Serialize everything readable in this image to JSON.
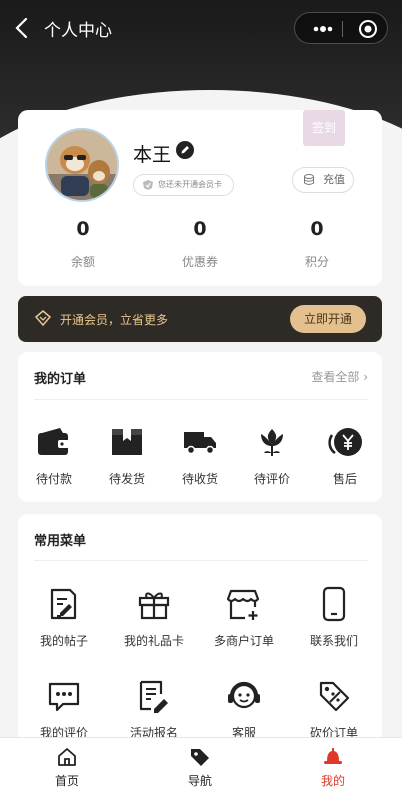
{
  "header": {
    "title": "个人中心"
  },
  "profile": {
    "username": "本王",
    "member_status": "您还未开通会员卡",
    "checkin_label": "签到",
    "recharge_label": "充值",
    "stats": [
      {
        "value": "0",
        "label": "余额"
      },
      {
        "value": "0",
        "label": "优惠券"
      },
      {
        "value": "0",
        "label": "积分"
      }
    ]
  },
  "vip": {
    "text": "开通会员，立省更多",
    "button": "立即开通"
  },
  "orders": {
    "title": "我的订单",
    "view_all": "查看全部",
    "items": [
      {
        "label": "待付款",
        "icon": "wallet-icon"
      },
      {
        "label": "待发货",
        "icon": "box-icon"
      },
      {
        "label": "待收货",
        "icon": "truck-icon"
      },
      {
        "label": "待评价",
        "icon": "flower-icon"
      },
      {
        "label": "售后",
        "icon": "yen-refund-icon"
      }
    ]
  },
  "menu": {
    "title": "常用菜单",
    "items": [
      {
        "label": "我的帖子",
        "icon": "post-edit-icon"
      },
      {
        "label": "我的礼品卡",
        "icon": "gift-icon"
      },
      {
        "label": "多商户订单",
        "icon": "store-add-icon"
      },
      {
        "label": "联系我们",
        "icon": "phone-icon"
      },
      {
        "label": "我的评价",
        "icon": "comment-icon"
      },
      {
        "label": "活动报名",
        "icon": "signup-doc-icon"
      },
      {
        "label": "客服",
        "icon": "headset-icon"
      },
      {
        "label": "砍价订单",
        "icon": "bargain-tag-icon"
      }
    ]
  },
  "tabbar": {
    "items": [
      {
        "label": "首页",
        "icon": "home-icon"
      },
      {
        "label": "导航",
        "icon": "tag-icon"
      },
      {
        "label": "我的",
        "icon": "profile-hat-icon"
      }
    ],
    "active_color": "#e0392b"
  },
  "colors": {
    "vip_gold": "#e3c08e",
    "vip_bg": "#2e2a26",
    "checkin_bg": "#e9d8e6"
  }
}
